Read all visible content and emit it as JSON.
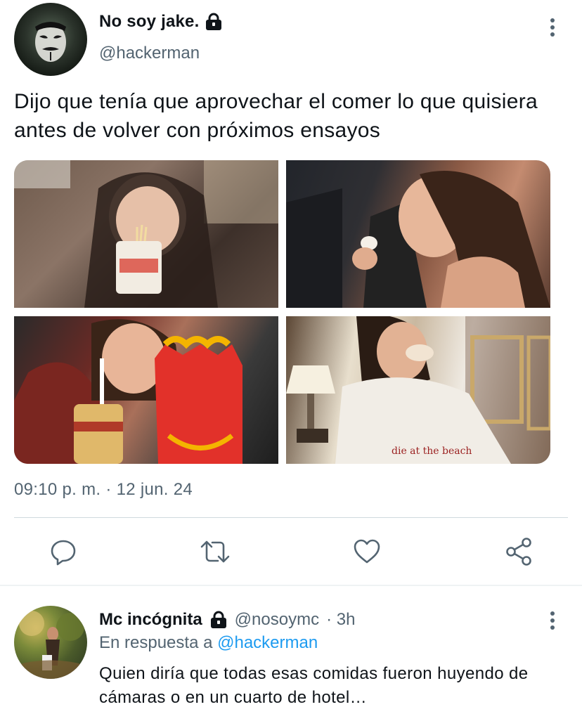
{
  "tweet": {
    "author": {
      "display_name": "No soy jake.",
      "handle": "@hackerman",
      "protected": true
    },
    "text": "Dijo que tenía que aprovechar el comer lo que quisiera antes de volver con próximos ensayos",
    "media": [
      {
        "alt": "Foto 1"
      },
      {
        "alt": "Foto 2"
      },
      {
        "alt": "Foto 3"
      },
      {
        "alt": "Foto 4"
      }
    ],
    "media_text": {
      "shirt_print": "die at the beach"
    },
    "timestamp": "09:10 p. m. · 12 jun. 24",
    "actions": [
      "reply-icon",
      "retweet-icon",
      "like-icon",
      "share-icon"
    ]
  },
  "reply": {
    "author": {
      "display_name": "Mc incógnita",
      "handle": "@nosoymc",
      "time": "· 3h",
      "protected": true
    },
    "in_reply_to_prefix": "En respuesta a",
    "in_reply_to_handle": "@hackerman",
    "text": "Quien diría que todas esas comidas fueron huyendo de cámaras o en un cuarto de hotel…"
  },
  "colors": {
    "text_primary": "#0f1419",
    "text_secondary": "#536471",
    "link": "#1d9bf0",
    "divider": "#cfd9de"
  }
}
